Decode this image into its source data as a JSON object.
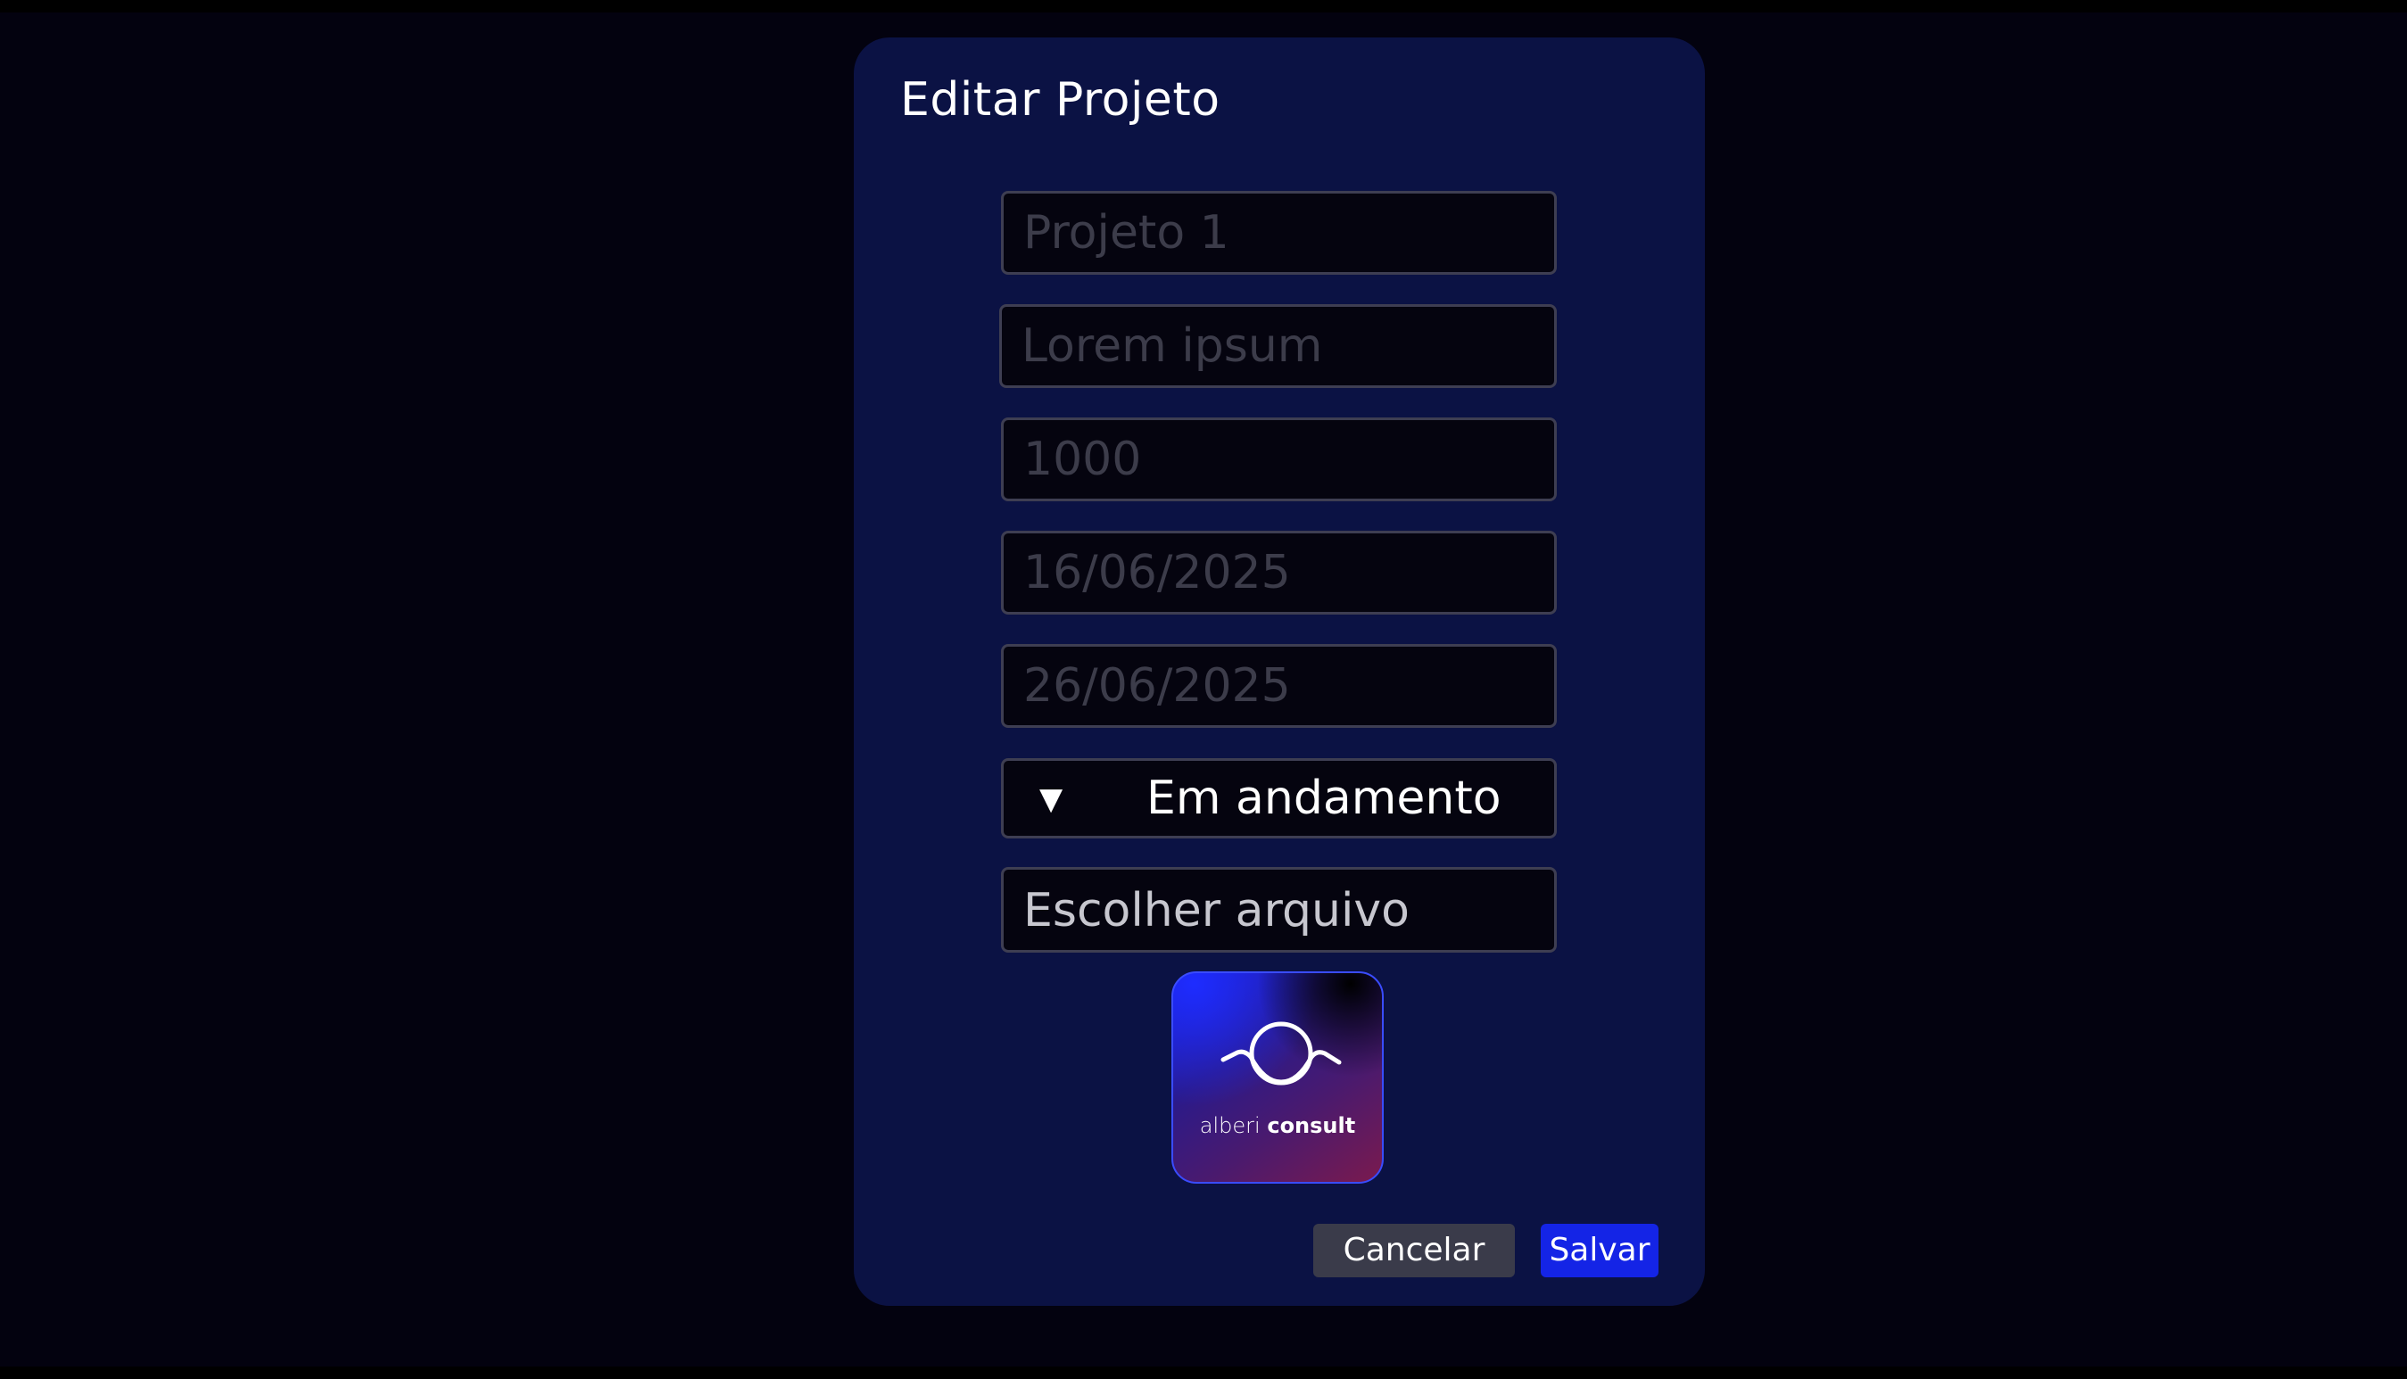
{
  "modal": {
    "title": "Editar Projeto"
  },
  "form": {
    "name_placeholder": "Projeto 1",
    "description_placeholder": "Lorem ipsum",
    "budget_placeholder": "1000",
    "start_date_placeholder": "16/06/2025",
    "end_date_placeholder": "26/06/2025",
    "status": {
      "arrow": "▼",
      "selected": "Em andamento"
    },
    "file_button_label": "Escolher arquivo"
  },
  "logo": {
    "text_light": "alberi",
    "text_bold": "consult"
  },
  "actions": {
    "cancel_label": "Cancelar",
    "save_label": "Salvar"
  },
  "colors": {
    "background": "#03020f",
    "modal": "#0b1244",
    "field_background": "#05040f",
    "save_button": "#1424e6",
    "cancel_button": "#3a3b4a"
  }
}
